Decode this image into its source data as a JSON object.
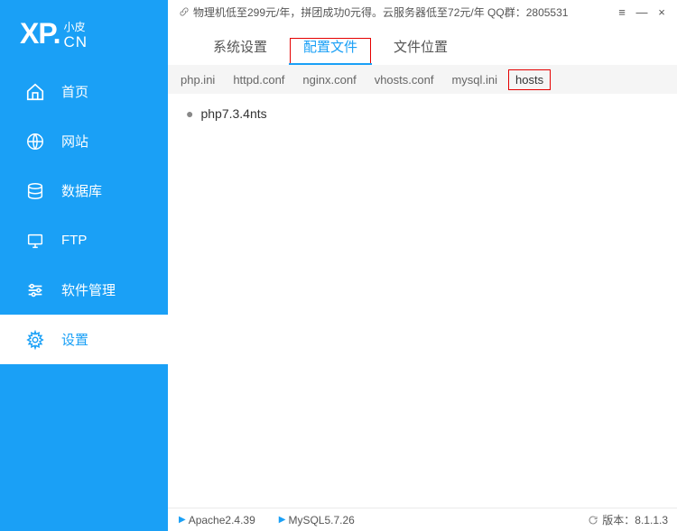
{
  "logo": {
    "main": "XP.",
    "small": "小皮",
    "cn": "CN"
  },
  "sidebar": [
    {
      "label": "首页"
    },
    {
      "label": "网站"
    },
    {
      "label": "数据库"
    },
    {
      "label": "FTP"
    },
    {
      "label": "软件管理"
    },
    {
      "label": "设置"
    }
  ],
  "titlebar": {
    "text": "物理机低至299元/年，拼团成功0元得。云服务器低至72元/年   QQ群：2805531"
  },
  "tabs": [
    {
      "label": "系统设置"
    },
    {
      "label": "配置文件"
    },
    {
      "label": "文件位置"
    }
  ],
  "subtabs": [
    {
      "label": "php.ini"
    },
    {
      "label": "httpd.conf"
    },
    {
      "label": "nginx.conf"
    },
    {
      "label": "vhosts.conf"
    },
    {
      "label": "mysql.ini"
    },
    {
      "label": "hosts"
    }
  ],
  "content": {
    "item": "php7.3.4nts"
  },
  "status": {
    "apache": "Apache2.4.39",
    "mysql": "MySQL5.7.26",
    "version_label": "版本：",
    "version": "8.1.1.3"
  },
  "window": {
    "pin": "≡",
    "min": "—",
    "close": "×"
  },
  "colors": {
    "brand": "#1aa0f6",
    "highlight": "#e50000"
  }
}
